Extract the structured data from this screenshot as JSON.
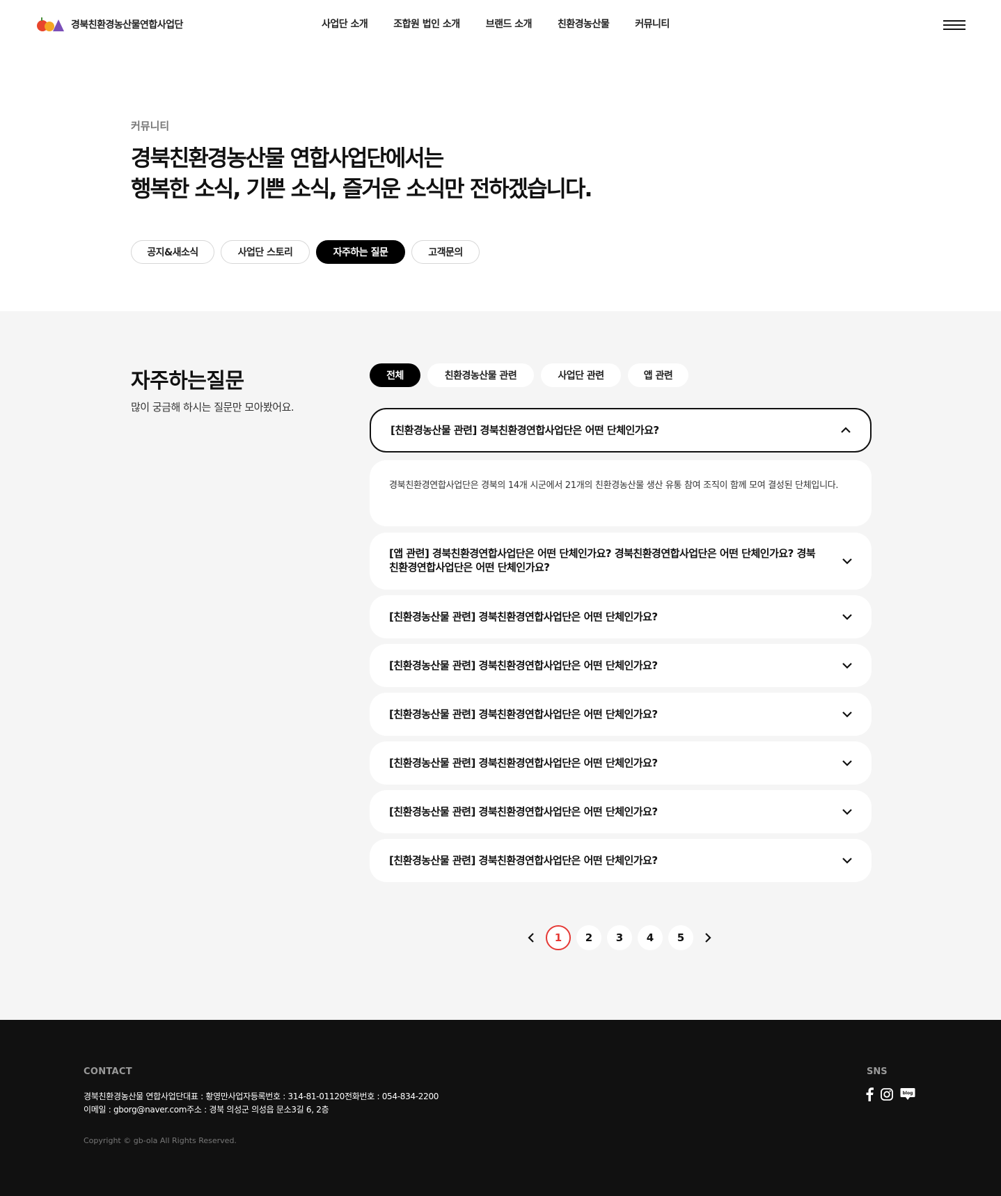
{
  "header": {
    "brand": "경북친환경농산물연합사업단",
    "nav": [
      "사업단 소개",
      "조합원 법인 소개",
      "브랜드 소개",
      "친환경농산물",
      "커뮤니티"
    ]
  },
  "hero": {
    "breadcrumb": "커뮤니티",
    "title_line1": "경북친환경농산물 연합사업단에서는",
    "title_line2": "행복한 소식, 기쁜 소식, 즐거운 소식만 전하겠습니다.",
    "tabs": [
      "공지&새소식",
      "사업단 스토리",
      "자주하는 질문",
      "고객문의"
    ],
    "active_tab": "자주하는 질문"
  },
  "faq": {
    "title": "자주하는질문",
    "subtitle": "많이 궁금해 하시는 질문만 모아봤어요.",
    "categories": [
      "전체",
      "친환경농산물 관련",
      "사업단 관련",
      "앱 관련"
    ],
    "active_category": "전체",
    "items": [
      {
        "question": "[친환경농산물 관련] 경북친환경연합사업단은 어떤 단체인가요?",
        "open": true,
        "answer": "경북친환경연합사업단은 경북의 14개 시군에서 21개의 친환경농산물 생산 유통 참여 조직이 함께 모여 결성된 단체입니다."
      },
      {
        "question": "[앱 관련] 경북친환경연합사업단은 어떤 단체인가요? 경북친환경연합사업단은 어떤 단체인가요? 경북친환경연합사업단은 어떤 단체인가요?",
        "open": false
      },
      {
        "question": "[친환경농산물 관련] 경북친환경연합사업단은 어떤 단체인가요?",
        "open": false
      },
      {
        "question": "[친환경농산물 관련] 경북친환경연합사업단은 어떤 단체인가요?",
        "open": false
      },
      {
        "question": "[친환경농산물 관련] 경북친환경연합사업단은 어떤 단체인가요?",
        "open": false
      },
      {
        "question": "[친환경농산물 관련] 경북친환경연합사업단은 어떤 단체인가요?",
        "open": false
      },
      {
        "question": "[친환경농산물 관련] 경북친환경연합사업단은 어떤 단체인가요?",
        "open": false
      },
      {
        "question": "[친환경농산물 관련] 경북친환경연합사업단은 어떤 단체인가요?",
        "open": false
      }
    ]
  },
  "pagination": {
    "pages": [
      "1",
      "2",
      "3",
      "4",
      "5"
    ],
    "current": "1"
  },
  "footer": {
    "contact_label": "CONTACT",
    "line1": "경북친환경농산물 연합사업단대표 : 황영만사업자등록번호 : 314-81-01120전화번호 : 054-834-2200",
    "line2": "이메일 : gborg@naver.com주소 : 경북 의성군 의성읍 문소3길 6, 2층",
    "copyright": "Copyright © gb-ola All Rights Reserved.",
    "sns_label": "SNS",
    "sns_icons": [
      "facebook-icon",
      "instagram-icon",
      "blog-icon"
    ],
    "blog_badge": "blog"
  },
  "colors": {
    "accent_red": "#e53935",
    "section_bg": "#f5f5f5",
    "footer_bg": "#111111",
    "logo_red": "#e8452c",
    "logo_orange": "#f5a623",
    "logo_purple": "#7b4fb8"
  }
}
